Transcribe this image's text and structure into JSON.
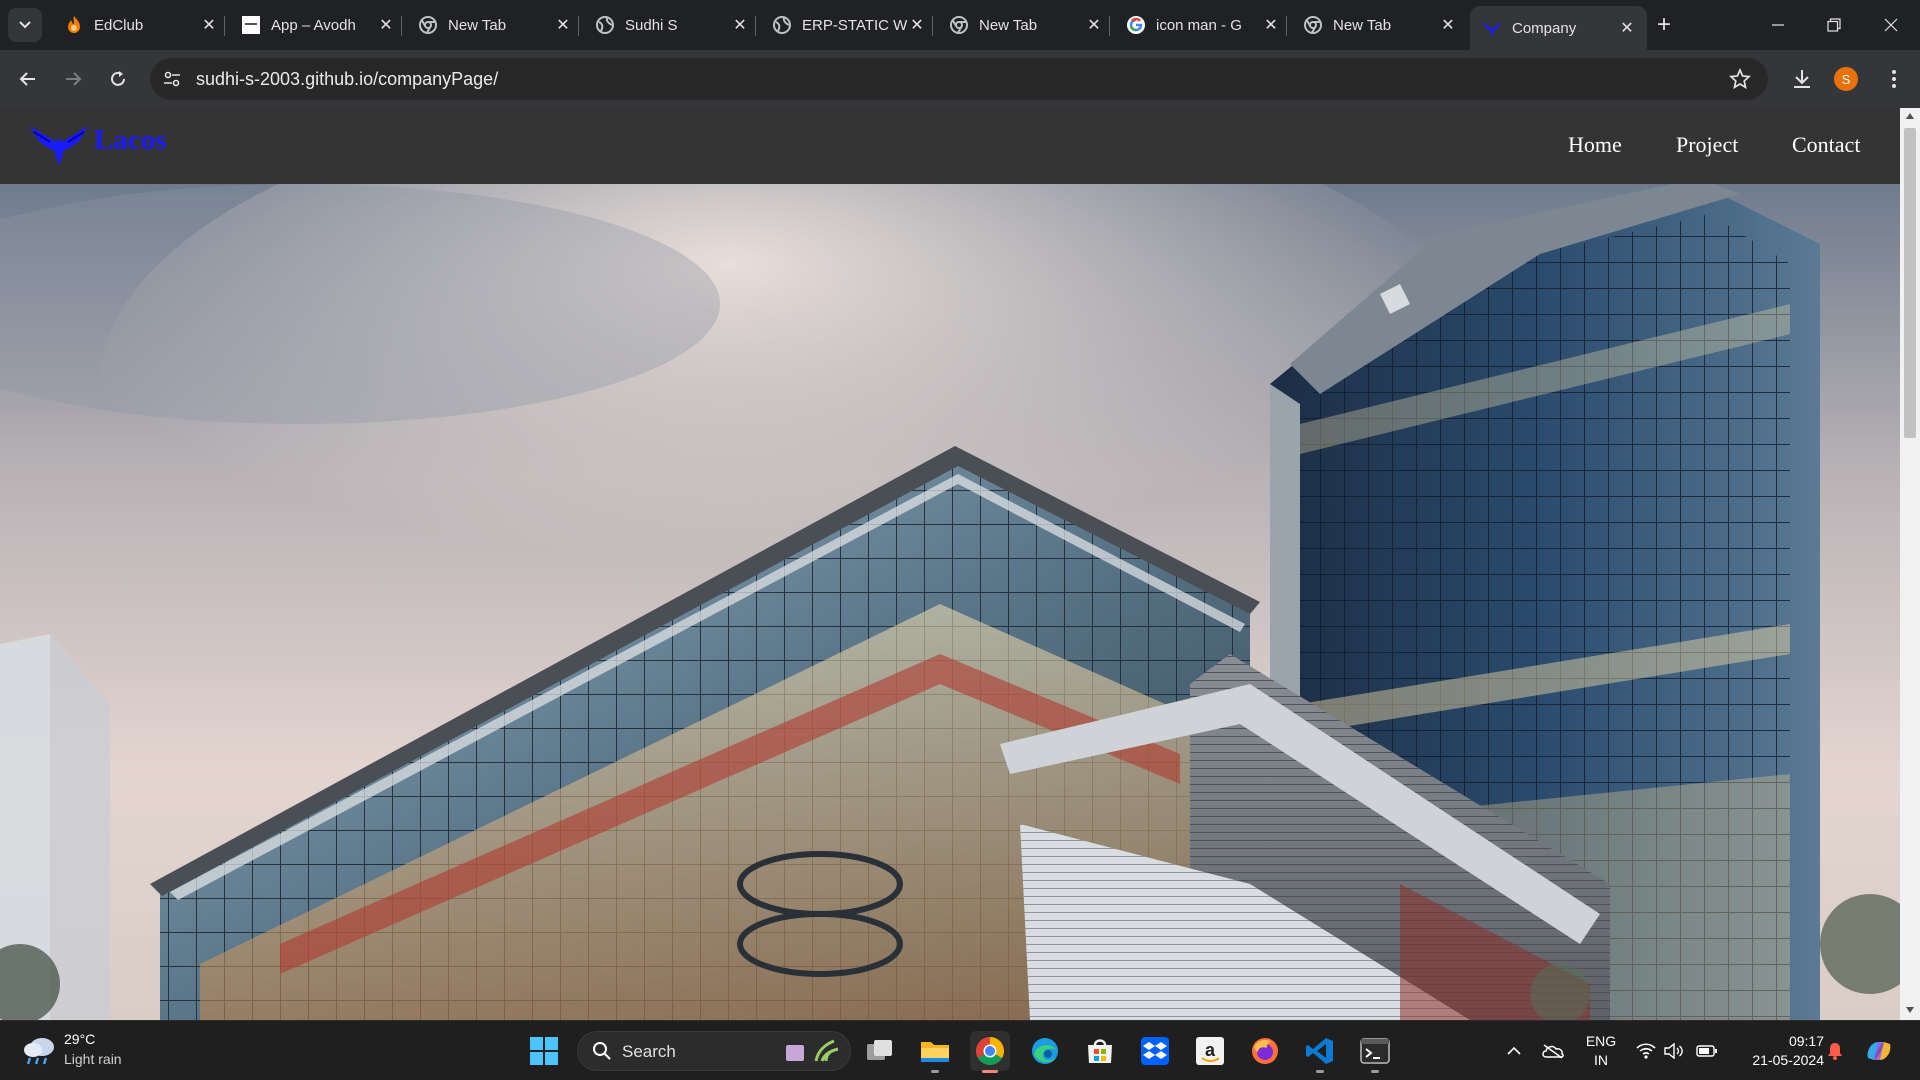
{
  "browser": {
    "tabs": [
      {
        "title": "EdClub",
        "favicon": "edclub-flame-icon"
      },
      {
        "title": "App – Avodh",
        "favicon": "blank-page-icon"
      },
      {
        "title": "New Tab",
        "favicon": "chrome-icon"
      },
      {
        "title": "Sudhi S",
        "favicon": "globe-icon"
      },
      {
        "title": "ERP-STATIC W",
        "favicon": "globe-icon"
      },
      {
        "title": "New Tab",
        "favicon": "chrome-icon"
      },
      {
        "title": "icon man - G",
        "favicon": "google-icon"
      },
      {
        "title": "New Tab",
        "favicon": "chrome-icon"
      },
      {
        "title": "Company",
        "favicon": "lacos-eagle-icon",
        "active": true
      }
    ],
    "url": "sudhi-s-2003.github.io/companyPage/",
    "profile_initial": "S",
    "profile_color": "#e8710a"
  },
  "site": {
    "logo_text": "Lacos",
    "logo_color": "#1a1aff",
    "header_bg": "#343434",
    "nav": [
      "Home",
      "Project",
      "Contact"
    ],
    "hero_image": "modern glass office building"
  },
  "taskbar": {
    "weather": {
      "temp": "29°C",
      "desc": "Light rain"
    },
    "search_label": "Search",
    "apps": [
      "windows-start-icon",
      "task-view-icon",
      "file-explorer-icon",
      "chrome-icon",
      "edge-icon",
      "microsoft-store-icon",
      "dropbox-icon",
      "amazon-icon",
      "firefox-icon",
      "vscode-icon",
      "terminal-icon"
    ],
    "tray": {
      "lang_line1": "ENG",
      "lang_line2": "IN",
      "time": "09:17",
      "date": "21-05-2024"
    }
  }
}
